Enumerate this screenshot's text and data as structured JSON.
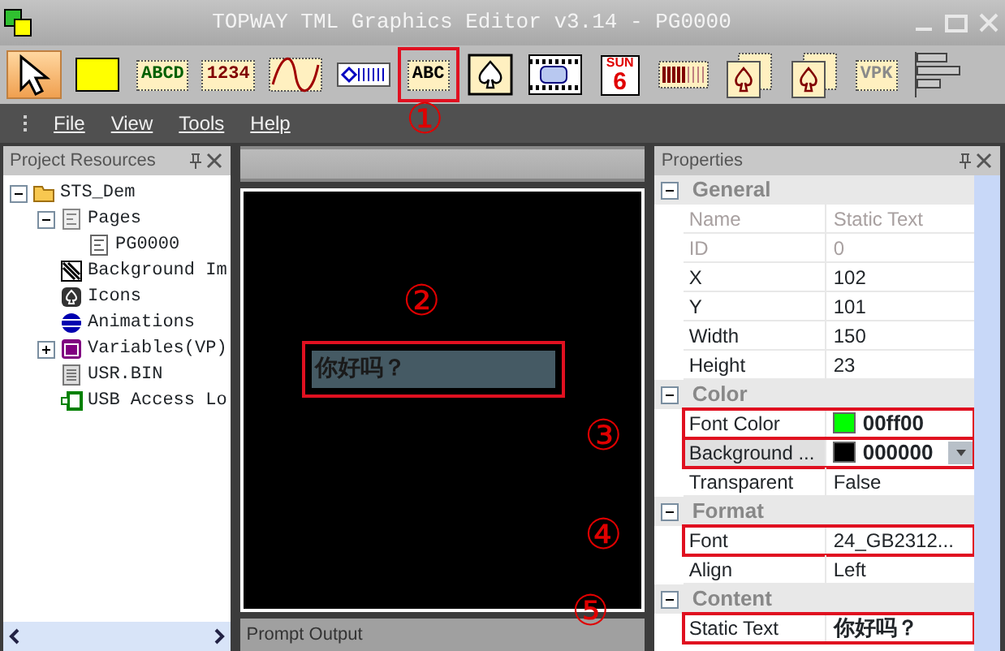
{
  "window": {
    "title": "TOPWAY TML Graphics Editor v3.14 - PG0000"
  },
  "toolbar": [
    {
      "kind": "pointer",
      "selected": true,
      "highlighted": false
    },
    {
      "kind": "rect",
      "selected": false,
      "highlighted": false
    },
    {
      "kind": "label",
      "text": "ABCD",
      "color": "#006000",
      "selected": false,
      "highlighted": false
    },
    {
      "kind": "label",
      "text": "1234",
      "color": "#800000",
      "selected": false,
      "highlighted": false
    },
    {
      "kind": "wave",
      "selected": false,
      "highlighted": false
    },
    {
      "kind": "slider",
      "selected": false,
      "highlighted": false
    },
    {
      "kind": "label",
      "text": "ABC",
      "color": "#000000",
      "selected": false,
      "highlighted": true
    },
    {
      "kind": "spade",
      "selected": false,
      "highlighted": false
    },
    {
      "kind": "film",
      "selected": false,
      "highlighted": false
    },
    {
      "kind": "calendar",
      "text": "SUN",
      "text2": "6",
      "selected": false,
      "highlighted": false
    },
    {
      "kind": "bars",
      "selected": false,
      "highlighted": false
    },
    {
      "kind": "cards",
      "selected": false,
      "highlighted": false
    },
    {
      "kind": "cards",
      "selected": false,
      "highlighted": false
    },
    {
      "kind": "label",
      "text": "VPK",
      "color": "#8a8a8a",
      "selected": false,
      "highlighted": false
    },
    {
      "kind": "align",
      "selected": false,
      "highlighted": false
    }
  ],
  "menu": [
    "File",
    "View",
    "Tools",
    "Help"
  ],
  "project_panel": {
    "title": "Project Resources",
    "tree": [
      {
        "label": "STS_Dem",
        "kind": "folder",
        "expanded": true,
        "children": [
          {
            "label": "Pages",
            "kind": "pages",
            "expanded": true,
            "children": [
              {
                "label": "PG0000",
                "kind": "page"
              }
            ]
          },
          {
            "label": "Background Im",
            "kind": "image"
          },
          {
            "label": "Icons",
            "kind": "icons"
          },
          {
            "label": "Animations",
            "kind": "anim"
          },
          {
            "label": "Variables(VP)",
            "kind": "vp",
            "expanded": false
          },
          {
            "label": "USR.BIN",
            "kind": "file"
          },
          {
            "label": "USB Access Lo",
            "kind": "usb"
          }
        ]
      }
    ]
  },
  "canvas": {
    "element": {
      "text": "你好吗？",
      "highlighted": true
    }
  },
  "output_panel": {
    "title": "Prompt Output"
  },
  "properties_panel": {
    "title": "Properties",
    "categories": [
      {
        "name": "General",
        "rows": [
          {
            "name": "Name",
            "value": "Static Text",
            "disabled": true
          },
          {
            "name": "ID",
            "value": "0",
            "disabled": true
          },
          {
            "name": "X",
            "value": "102",
            "disabled": false
          },
          {
            "name": "Y",
            "value": "101",
            "disabled": false
          },
          {
            "name": "Width",
            "value": "150",
            "disabled": false
          },
          {
            "name": "Height",
            "value": "23",
            "disabled": false
          }
        ]
      },
      {
        "name": "Color",
        "rows": [
          {
            "name": "Font Color",
            "value": "00ff00",
            "disabled": false,
            "color": "#00ff00",
            "highlighted": true
          },
          {
            "name": "Background ...",
            "value": "000000",
            "disabled": false,
            "color": "#000000",
            "highlighted": true,
            "dropdown": true,
            "selected": true
          },
          {
            "name": "Transparent",
            "value": "False",
            "disabled": false
          }
        ]
      },
      {
        "name": "Format",
        "rows": [
          {
            "name": "Font",
            "value": "24_GB2312...",
            "disabled": false,
            "highlighted": true
          },
          {
            "name": "Align",
            "value": "Left",
            "disabled": false
          }
        ]
      },
      {
        "name": "Content",
        "rows": [
          {
            "name": "Static Text",
            "value": "你好吗？",
            "disabled": false,
            "highlighted": true,
            "bold": true
          }
        ]
      }
    ]
  },
  "annotations": [
    {
      "label": "①"
    },
    {
      "label": "②"
    },
    {
      "label": "③"
    },
    {
      "label": "④"
    },
    {
      "label": "⑤"
    }
  ]
}
